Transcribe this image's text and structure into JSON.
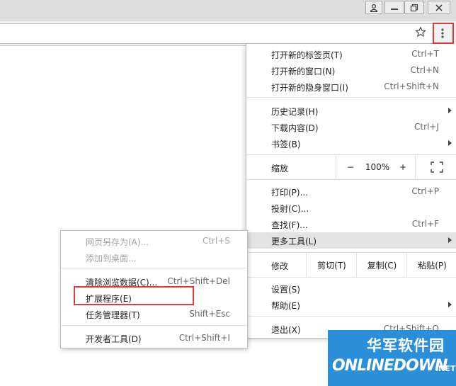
{
  "menu": {
    "new_tab": {
      "label": "打开新的标签页(T)",
      "shortcut": "Ctrl+T"
    },
    "new_window": {
      "label": "打开新的窗口(N)",
      "shortcut": "Ctrl+N"
    },
    "incognito": {
      "label": "打开新的隐身窗口(I)",
      "shortcut": "Ctrl+Shift+N"
    },
    "history": {
      "label": "历史记录(H)"
    },
    "downloads": {
      "label": "下载内容(D)",
      "shortcut": "Ctrl+J"
    },
    "bookmarks": {
      "label": "书签(B)"
    },
    "zoom": {
      "label": "缩放",
      "minus": "−",
      "value": "100%",
      "plus": "+"
    },
    "print": {
      "label": "打印(P)...",
      "shortcut": "Ctrl+P"
    },
    "cast": {
      "label": "投射(C)..."
    },
    "find": {
      "label": "查找(F)...",
      "shortcut": "Ctrl+F"
    },
    "more_tools": {
      "label": "更多工具(L)"
    },
    "edit": {
      "label": "修改",
      "cut": "剪切(T)",
      "copy": "复制(C)",
      "paste": "粘贴(P)"
    },
    "settings": {
      "label": "设置(S)"
    },
    "help": {
      "label": "帮助(E)"
    },
    "exit": {
      "label": "退出(X)",
      "shortcut": "Ctrl+Shift+Q"
    }
  },
  "submenu": {
    "save_page": {
      "label": "网页另存为(A)...",
      "shortcut": "Ctrl+S"
    },
    "add_to_desktop": {
      "label": "添加到桌面..."
    },
    "clear_data": {
      "label": "清除浏览数据(C)...",
      "shortcut": "Ctrl+Shift+Del"
    },
    "extensions": {
      "label": "扩展程序(E)"
    },
    "task_manager": {
      "label": "任务管理器(T)",
      "shortcut": "Shift+Esc"
    },
    "dev_tools": {
      "label": "开发者工具(D)",
      "shortcut": "Ctrl+Shift+I"
    }
  },
  "watermark": {
    "cn": "华军软件园",
    "en": "ONLINEDOWN",
    "suffix": ".NET"
  },
  "colors": {
    "highlight_outline": "#e23b3b",
    "hover_bg": "#e3e3e3",
    "watermark_bg": "#2a8fd8"
  }
}
